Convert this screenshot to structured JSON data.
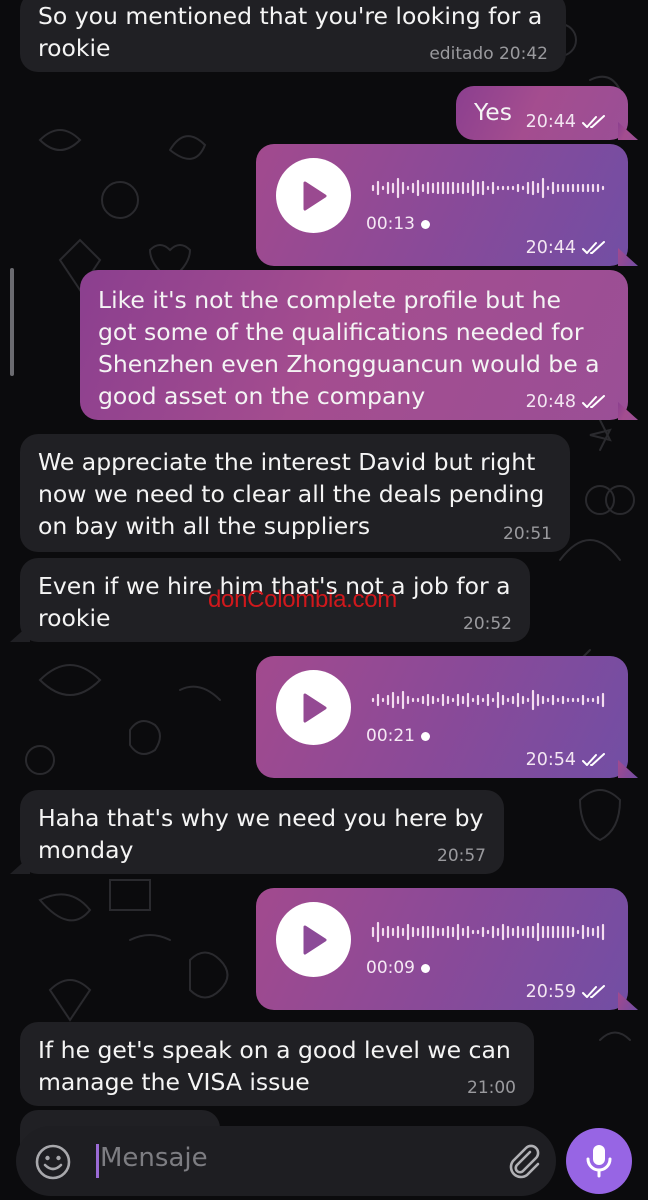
{
  "messages": [
    {
      "id": "m1",
      "dir": "in",
      "text_lines": [
        "So you mentioned that you're looking for a",
        "rookie"
      ],
      "time": "editado 20:42"
    },
    {
      "id": "m2",
      "dir": "out",
      "text": "Yes",
      "time": "20:44"
    },
    {
      "id": "m3",
      "dir": "out",
      "type": "voice",
      "duration": "00:13",
      "time": "20:44"
    },
    {
      "id": "m4",
      "dir": "out",
      "text_lines": [
        "Like it's not the complete profile but he",
        "got some of the qualifications needed for",
        "Shenzhen even Zhongguancun would be a",
        "good asset on the company"
      ],
      "time": "20:48"
    },
    {
      "id": "m5",
      "dir": "in",
      "text_lines": [
        "We appreciate the interest David but right",
        "now we need to clear all the deals pending",
        "on bay with all the suppliers"
      ],
      "time": "20:51"
    },
    {
      "id": "m6",
      "dir": "in",
      "text_lines": [
        "Even if we hire him that's not a job for a",
        "rookie"
      ],
      "time": "20:52"
    },
    {
      "id": "m7",
      "dir": "out",
      "type": "voice",
      "duration": "00:21",
      "time": "20:54"
    },
    {
      "id": "m8",
      "dir": "in",
      "text_lines": [
        "Haha that's why we need you here by",
        "monday"
      ],
      "time": "20:57"
    },
    {
      "id": "m9",
      "dir": "out",
      "type": "voice",
      "duration": "00:09",
      "time": "20:59"
    },
    {
      "id": "m10",
      "dir": "in",
      "text_lines": [
        "If he get's speak on a good level we can",
        "manage the VISA issue"
      ],
      "time": "21:00"
    }
  ],
  "watermark": "donColombia.com",
  "input": {
    "placeholder": "Mensaje"
  },
  "icons": {
    "emoji": "emoji-icon",
    "attach": "paperclip-icon",
    "mic": "microphone-icon",
    "play": "play-icon",
    "read": "double-check-icon"
  },
  "colors": {
    "background": "#0b0b0d",
    "incoming_bubble": "#202024",
    "outgoing_bubble": "#a44d8f",
    "mic_button": "#9765e4",
    "watermark": "#d0181c"
  }
}
